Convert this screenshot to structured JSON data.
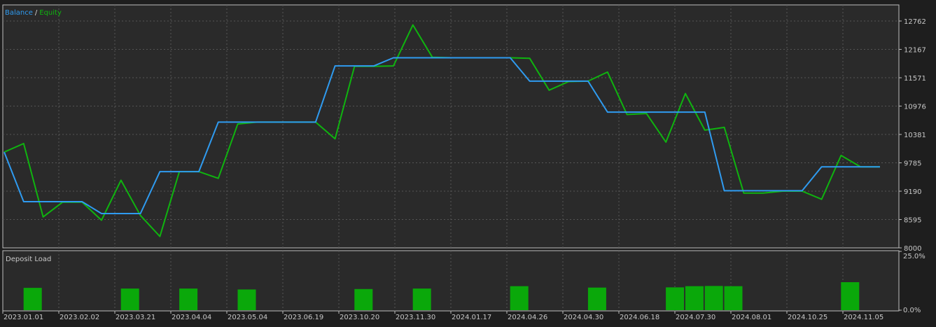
{
  "legend": {
    "balance": "Balance",
    "separator": "/",
    "equity": "Equity"
  },
  "colors": {
    "balance": "#2f9bf0",
    "equity": "#0fb40f",
    "bars": "#0aa80a",
    "background": "#2a2a2a",
    "grid": "#555555",
    "frame": "#bfbfbf",
    "text": "#c8c8c8"
  },
  "chart_data": [
    {
      "type": "line",
      "title": "",
      "legend_position": "top-left",
      "grid": true,
      "ylim": [
        8000,
        13100
      ],
      "y_ticks": [
        "12762",
        "12167",
        "11571",
        "10976",
        "10381",
        "9785",
        "9190",
        "8595",
        "8000"
      ],
      "x_ticks": [
        "2023.01.01",
        "2023.02.02",
        "2023.03.21",
        "2023.04.04",
        "2023.05.04",
        "2023.06.19",
        "2023.10.20",
        "2023.11.30",
        "2024.01.17",
        "2024.04.26",
        "2024.04.30",
        "2024.06.18",
        "2024.07.30",
        "2024.08.01",
        "2024.10.25",
        "2024.11.05"
      ],
      "x": [
        0,
        1,
        2,
        3,
        4,
        5,
        6,
        7,
        8,
        9,
        10,
        11,
        12,
        13,
        14,
        15,
        16,
        17,
        18,
        19,
        20,
        21,
        22,
        23,
        24,
        25,
        26,
        27,
        28,
        29,
        30,
        31,
        32,
        33,
        34,
        35,
        36,
        37,
        38,
        39,
        40,
        41,
        42,
        43,
        44,
        45
      ],
      "series": [
        {
          "name": "Balance",
          "values": [
            10010,
            8970,
            8970,
            8970,
            8970,
            8720,
            8720,
            8720,
            9600,
            9600,
            9600,
            10640,
            10640,
            10640,
            10640,
            10640,
            10640,
            11820,
            11820,
            11820,
            11990,
            11990,
            11990,
            11990,
            11990,
            11990,
            11990,
            11500,
            11500,
            11500,
            11500,
            10850,
            10850,
            10850,
            10850,
            10850,
            10850,
            9200,
            9200,
            9200,
            9200,
            9200,
            9700,
            9700,
            9700,
            9700
          ]
        },
        {
          "name": "Equity",
          "values": [
            10010,
            10190,
            8650,
            8960,
            8960,
            8580,
            9420,
            8680,
            8240,
            9600,
            9600,
            9460,
            10600,
            10640,
            10640,
            10640,
            10640,
            10290,
            11810,
            11810,
            11820,
            12680,
            12000,
            11990,
            11990,
            11990,
            11990,
            11980,
            11310,
            11490,
            11500,
            11690,
            10800,
            10820,
            10220,
            11240,
            10470,
            10530,
            9150,
            9150,
            9190,
            9190,
            9020,
            9940,
            9700,
            9700
          ]
        }
      ]
    },
    {
      "type": "bar",
      "title": "Deposit Load",
      "ylim": [
        0,
        25
      ],
      "y_ticks": [
        "25.0%",
        "0.0%"
      ],
      "unit": "%",
      "x": [
        1,
        6,
        9,
        12,
        18,
        21,
        26,
        30,
        34,
        35,
        36,
        37,
        43
      ],
      "values": [
        9.5,
        9.2,
        9.2,
        8.8,
        9,
        9.2,
        10.2,
        9.6,
        9.7,
        10.2,
        10.3,
        10.2,
        11.9
      ]
    }
  ]
}
